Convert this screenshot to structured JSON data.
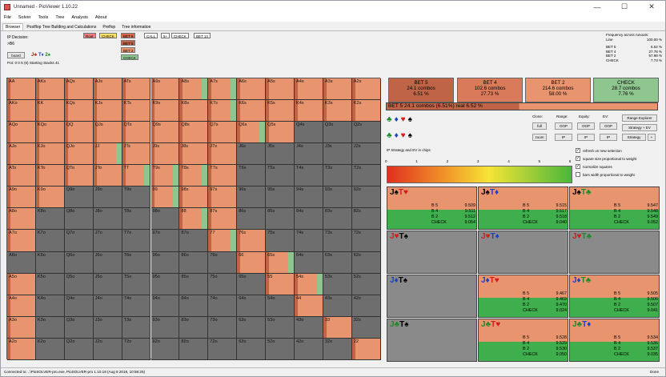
{
  "window": {
    "title": "Unnamed - PioViewer 1.10.22",
    "controls": [
      "—",
      "☐",
      "✕"
    ]
  },
  "menu": [
    "File",
    "Solver",
    "Tools",
    "Tree",
    "Analysis",
    "About"
  ],
  "tabs": [
    "Browser",
    "Postflop Tree Building and Calculations",
    "Preflop",
    "Tree information"
  ],
  "decision": {
    "title": "IP Decision:",
    "path": ">B6",
    "board_button": "board",
    "board_cards": [
      {
        "t": "J",
        "s": "♣",
        "c": "red"
      },
      {
        "t": "T",
        "s": "♦",
        "c": "blue"
      },
      {
        "t": "2",
        "s": "♠",
        "c": "green"
      }
    ],
    "pot": "Pot: 0 0 6 (6) Starting Stacks 41"
  },
  "tree_nodes": [
    {
      "label": "Root",
      "bg": "#f08080"
    },
    {
      "label": "CHECK",
      "bg": "#ffe36b"
    },
    {
      "label": "BET 6",
      "bg": "#d46a4a"
    },
    {
      "label": "CALL",
      "bg": "#ffffff"
    },
    {
      "label": "5+",
      "bg": "#ffffff"
    },
    {
      "label": "CHECK",
      "bg": "#ffffff"
    },
    {
      "label": "BET 14",
      "bg": "#ffffff"
    },
    {
      "label": "BET 5",
      "bg": "#c06448"
    },
    {
      "label": "BET 2",
      "bg": "#e8956f"
    },
    {
      "label": "CHECK",
      "bg": "#8fc58f"
    }
  ],
  "freq": {
    "title": "Frequency across runouts:",
    "rows": [
      [
        "Line",
        "100.00 %"
      ],
      [
        "BET 5",
        "6.52 %"
      ],
      [
        "BET 4",
        "27.78 %"
      ],
      [
        "BET 2",
        "57.98 %"
      ],
      [
        "CHECK",
        "7.73 %"
      ]
    ]
  },
  "ranks": [
    "A",
    "K",
    "Q",
    "J",
    "T",
    "9",
    "8",
    "7",
    "6",
    "5",
    "4",
    "3",
    "2"
  ],
  "grid_rows": [
    [
      "r",
      "r",
      "r",
      "r",
      "r",
      "r",
      "r",
      "r",
      "r",
      "r",
      "r",
      "r",
      "r"
    ],
    [
      "r",
      "r",
      "r",
      "r",
      "r",
      "r",
      "r",
      "r",
      "r",
      "r",
      "r",
      "r",
      "r"
    ],
    [
      "r",
      "r",
      "r",
      "r",
      "r",
      "r",
      "r",
      "r",
      "r",
      "r",
      "g",
      "g",
      "g"
    ],
    [
      "r",
      "r",
      "r",
      "r",
      "r",
      "r",
      "r",
      "r",
      "g",
      "g",
      "g",
      "g",
      "g"
    ],
    [
      "r",
      "r",
      "r",
      "r",
      "r",
      "r",
      "r",
      "r",
      "g",
      "g",
      "g",
      "g",
      "g"
    ],
    [
      "r",
      "r",
      "g",
      "g",
      "g",
      "r",
      "r",
      "r",
      "g",
      "g",
      "g",
      "g",
      "g"
    ],
    [
      "r",
      "g",
      "g",
      "g",
      "g",
      "g",
      "r",
      "r",
      "g",
      "g",
      "g",
      "g",
      "g"
    ],
    [
      "r",
      "g",
      "g",
      "g",
      "g",
      "g",
      "g",
      "r",
      "r",
      "g",
      "g",
      "g",
      "g"
    ],
    [
      "g",
      "g",
      "g",
      "g",
      "g",
      "g",
      "g",
      "g",
      "r",
      "r",
      "g",
      "g",
      "g"
    ],
    [
      "r",
      "g",
      "g",
      "g",
      "g",
      "g",
      "g",
      "g",
      "g",
      "r",
      "r",
      "g",
      "g"
    ],
    [
      "r",
      "g",
      "g",
      "g",
      "g",
      "g",
      "g",
      "g",
      "g",
      "g",
      "r",
      "g",
      "g"
    ],
    [
      "r",
      "g",
      "g",
      "g",
      "g",
      "g",
      "g",
      "g",
      "g",
      "g",
      "g",
      "r",
      "g"
    ],
    [
      "r",
      "g",
      "g",
      "g",
      "g",
      "g",
      "g",
      "g",
      "g",
      "g",
      "g",
      "g",
      "r"
    ]
  ],
  "green_stripes": [
    [
      0,
      6
    ],
    [
      0,
      7
    ],
    [
      1,
      7
    ],
    [
      2,
      8
    ],
    [
      3,
      3
    ],
    [
      4,
      4
    ],
    [
      4,
      5
    ],
    [
      4,
      6
    ],
    [
      5,
      5
    ],
    [
      6,
      6
    ],
    [
      7,
      7
    ],
    [
      8,
      9
    ],
    [
      9,
      10
    ]
  ],
  "actions": [
    {
      "name": "BET 5",
      "combos": "24.1 combos",
      "pct": "6.51 %",
      "bg": "#c06448"
    },
    {
      "name": "BET 4",
      "combos": "102.6 combos",
      "pct": "27.73 %",
      "bg": "#d97b5a"
    },
    {
      "name": "BET 2",
      "combos": "214.6 combos",
      "pct": "58.00 %",
      "bg": "#e8956f"
    },
    {
      "name": "CHECK",
      "combos": "28.7 combos",
      "pct": "7.76 %",
      "bg": "#8fc58f"
    }
  ],
  "selected": "BET 5   24.1 combos (6.51%) real  6.52 %",
  "suit_rows": [
    [
      "♣",
      "♦",
      "♥",
      "♠"
    ],
    [
      "♣",
      "♦",
      "♥",
      "♠"
    ]
  ],
  "panel": {
    "labels": [
      "Clone:",
      "Range:",
      "Equity:",
      "EV:"
    ],
    "buttons": [
      "full",
      "OOP",
      "OOP",
      "OOP",
      "Range Explorer",
      "zoom",
      "IP",
      "IP",
      "IP",
      "Strategy + EV",
      "Strategy",
      "+"
    ],
    "checks": [
      [
        "✓",
        "refresh on new selection"
      ],
      [
        "✓",
        "square size proportional to weight"
      ],
      [
        "✓",
        "normalize squares"
      ],
      [
        "",
        "bars width proportional to weight"
      ]
    ],
    "caption": "IP Strategy and EV in chips"
  },
  "scale_ticks": [
    "0",
    "1",
    "2",
    "3",
    "4",
    "5",
    "6"
  ],
  "combos": [
    {
      "c1": "J",
      "s1": "♠",
      "k1": "black",
      "c2": "T",
      "s2": "♥",
      "k2": "red",
      "vals": [
        [
          "B 5",
          "9.509"
        ],
        [
          "B 4",
          "9.511"
        ],
        [
          "B 2",
          "9.512"
        ],
        [
          "CHECK",
          "9.054"
        ]
      ]
    },
    {
      "c1": "J",
      "s1": "♠",
      "k1": "black",
      "c2": "T",
      "s2": "♦",
      "k2": "blue",
      "vals": [
        [
          "B 5",
          "9.515"
        ],
        [
          "B 4",
          "9.517"
        ],
        [
          "B 2",
          "9.518"
        ],
        [
          "CHECK",
          "9.040"
        ]
      ]
    },
    {
      "c1": "J",
      "s1": "♠",
      "k1": "black",
      "c2": "T",
      "s2": "♣",
      "k2": "green",
      "vals": [
        [
          "B 5",
          "9.547"
        ],
        [
          "B 4",
          "9.548"
        ],
        [
          "B 2",
          "9.549"
        ],
        [
          "CHECK",
          "9.052"
        ]
      ]
    },
    {
      "c1": "J",
      "s1": "♥",
      "k1": "red",
      "c2": "T",
      "s2": "♠",
      "k2": "black",
      "vals": []
    },
    {
      "c1": "J",
      "s1": "♥",
      "k1": "red",
      "c2": "T",
      "s2": "♦",
      "k2": "blue",
      "vals": []
    },
    {
      "c1": "J",
      "s1": "♥",
      "k1": "red",
      "c2": "T",
      "s2": "♣",
      "k2": "green",
      "vals": []
    },
    {
      "c1": "J",
      "s1": "♦",
      "k1": "blue",
      "c2": "T",
      "s2": "♠",
      "k2": "black",
      "vals": []
    },
    {
      "c1": "J",
      "s1": "♦",
      "k1": "blue",
      "c2": "T",
      "s2": "♥",
      "k2": "red",
      "vals": [
        [
          "B 5",
          "9.467"
        ],
        [
          "B 4",
          "9.469"
        ],
        [
          "B 2",
          "9.470"
        ],
        [
          "CHECK",
          "9.024"
        ]
      ]
    },
    {
      "c1": "J",
      "s1": "♦",
      "k1": "blue",
      "c2": "T",
      "s2": "♣",
      "k2": "green",
      "vals": [
        [
          "B 5",
          "9.505"
        ],
        [
          "B 4",
          "9.506"
        ],
        [
          "B 2",
          "9.507"
        ],
        [
          "CHECK",
          "9.041"
        ]
      ]
    },
    {
      "c1": "J",
      "s1": "♣",
      "k1": "green",
      "c2": "T",
      "s2": "♠",
      "k2": "black",
      "vals": []
    },
    {
      "c1": "J",
      "s1": "♣",
      "k1": "green",
      "c2": "T",
      "s2": "♥",
      "k2": "red",
      "vals": [
        [
          "B 5",
          "9.528"
        ],
        [
          "B 4",
          "9.529"
        ],
        [
          "B 2",
          "9.530"
        ],
        [
          "CHECK",
          "9.050"
        ]
      ]
    },
    {
      "c1": "J",
      "s1": "♣",
      "k1": "green",
      "c2": "T",
      "s2": "♦",
      "k2": "blue",
      "vals": [
        [
          "B 5",
          "9.534"
        ],
        [
          "B 4",
          "9.536"
        ],
        [
          "B 2",
          "9.537"
        ],
        [
          "CHECK",
          "9.035"
        ]
      ]
    }
  ],
  "status": {
    "text": "Connected to: ..\\PioSOLVER-pro.exe, PioSOLVER-pro 1.10.19 (Aug  8 2018, 10:58:25)",
    "done": "Done"
  },
  "colors": {
    "red_cell": "#e8956f",
    "dark_red": "#c06448",
    "gray_cell": "#6e6e6e",
    "green": "#8fc58f"
  }
}
